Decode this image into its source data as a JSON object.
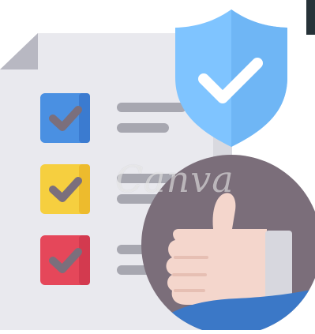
{
  "watermark": {
    "text": "Canva"
  },
  "colors": {
    "document": "#e9e9ee",
    "document_fold": "#b8b8c2",
    "line": "#a7a7b0",
    "checkbox_blue": "#4a90e2",
    "checkbox_yellow": "#f6cf3f",
    "checkbox_red": "#e5475a",
    "check_mark": "#7b6f7c",
    "shield": "#7fc4ff",
    "shield_check": "#ffffff",
    "avatar_bg": "#7b6e7a",
    "skin": "#f4d6cc",
    "cuff": "#d7d7de",
    "sleeve": "#3b78c7",
    "dark_corner": "#263238"
  },
  "icons": {
    "document": "document-icon",
    "checkbox_1": "checked-checkbox-icon",
    "checkbox_2": "checked-checkbox-icon",
    "checkbox_3": "checked-checkbox-icon",
    "shield": "shield-check-icon",
    "thumbs_up": "thumbs-up-icon"
  }
}
